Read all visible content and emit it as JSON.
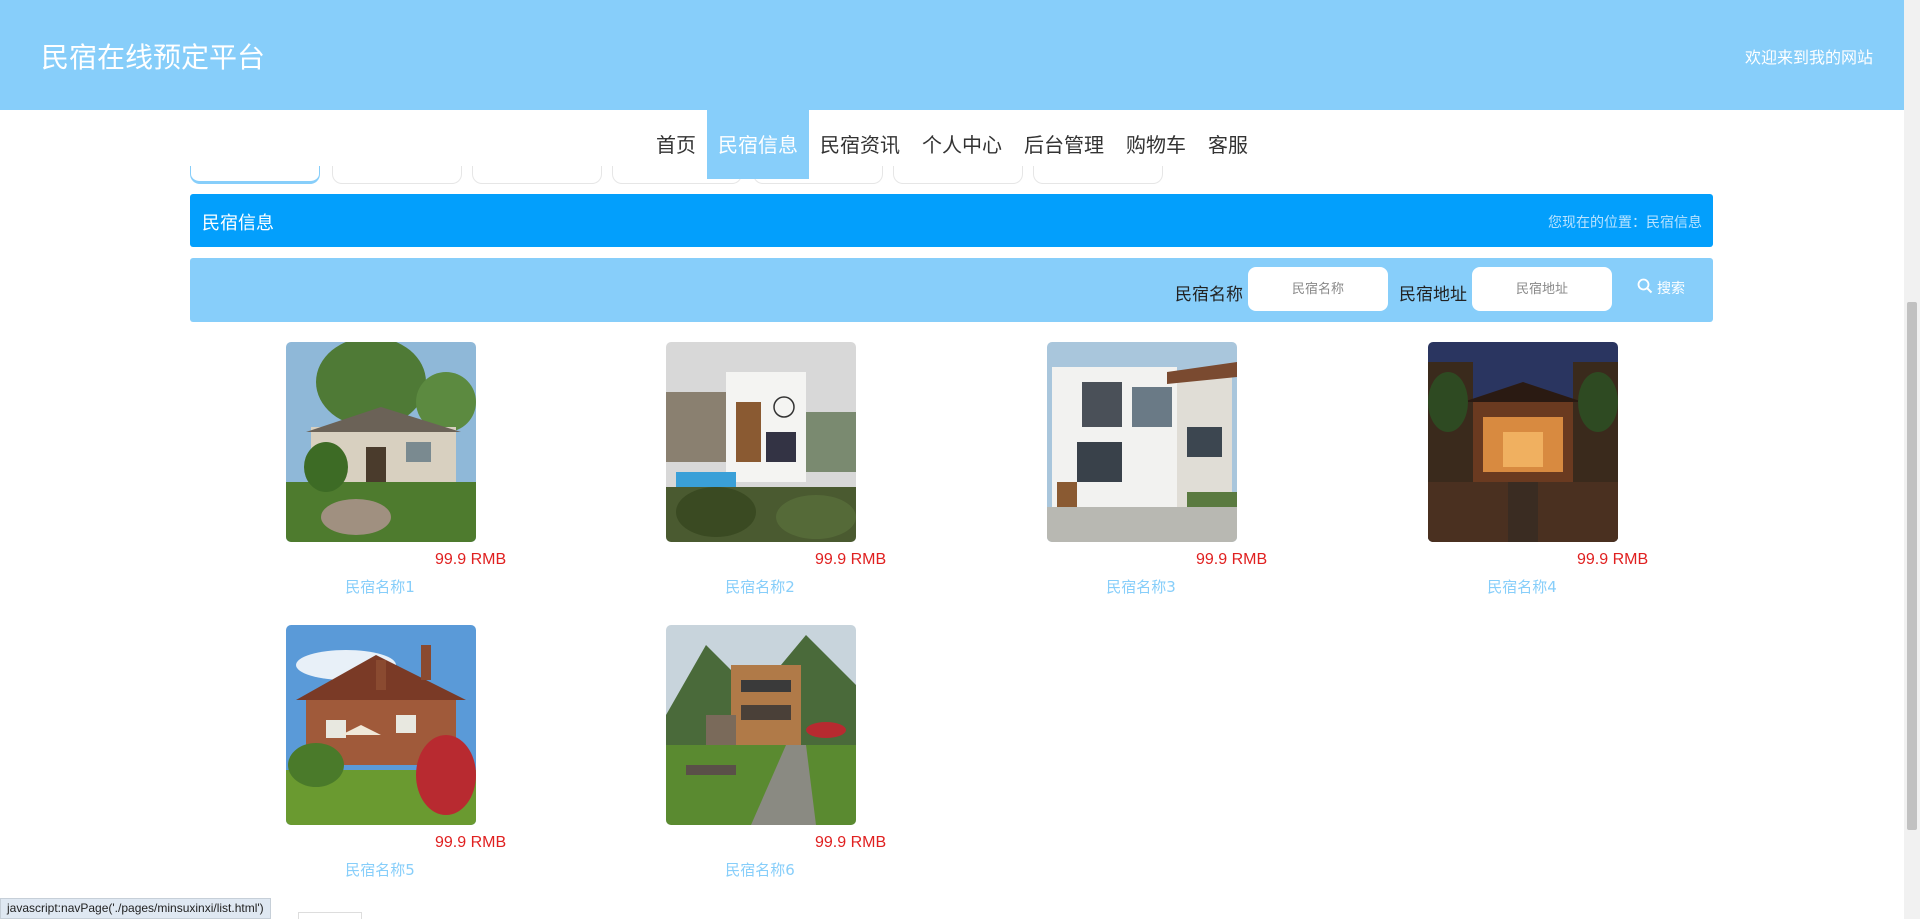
{
  "header": {
    "site_title": "民宿在线预定平台",
    "welcome": "欢迎来到我的网站"
  },
  "nav": {
    "items": [
      {
        "label": "首页",
        "active": false
      },
      {
        "label": "民宿信息",
        "active": true
      },
      {
        "label": "民宿资讯",
        "active": false
      },
      {
        "label": "个人中心",
        "active": false
      },
      {
        "label": "后台管理",
        "active": false
      },
      {
        "label": "购物车",
        "active": false
      },
      {
        "label": "客服",
        "active": false
      }
    ]
  },
  "page": {
    "title": "民宿信息",
    "breadcrumb": "您现在的位置：民宿信息"
  },
  "search": {
    "name_label": "民宿名称",
    "name_placeholder": "民宿名称",
    "address_label": "民宿地址",
    "address_placeholder": "民宿地址",
    "button_label": "搜索"
  },
  "listings": [
    {
      "name": "民宿名称1",
      "price": "99.9 RMB",
      "image": "cottage-garden"
    },
    {
      "name": "民宿名称2",
      "price": "99.9 RMB",
      "image": "modern-villa-pool"
    },
    {
      "name": "民宿名称3",
      "price": "99.9 RMB",
      "image": "modern-townhouse"
    },
    {
      "name": "民宿名称4",
      "price": "99.9 RMB",
      "image": "courtyard-night"
    },
    {
      "name": "民宿名称5",
      "price": "99.9 RMB",
      "image": "brick-cottage"
    },
    {
      "name": "民宿名称6",
      "price": "99.9 RMB",
      "image": "mountain-lodge"
    }
  ],
  "status_bar": {
    "text": "javascript:navPage('./pages/minsuxinxi/list.html')"
  },
  "colors": {
    "header_bg": "#87cefa",
    "title_bar_bg": "#039ffc",
    "price": "#e02020",
    "name_link": "#87cefa"
  }
}
